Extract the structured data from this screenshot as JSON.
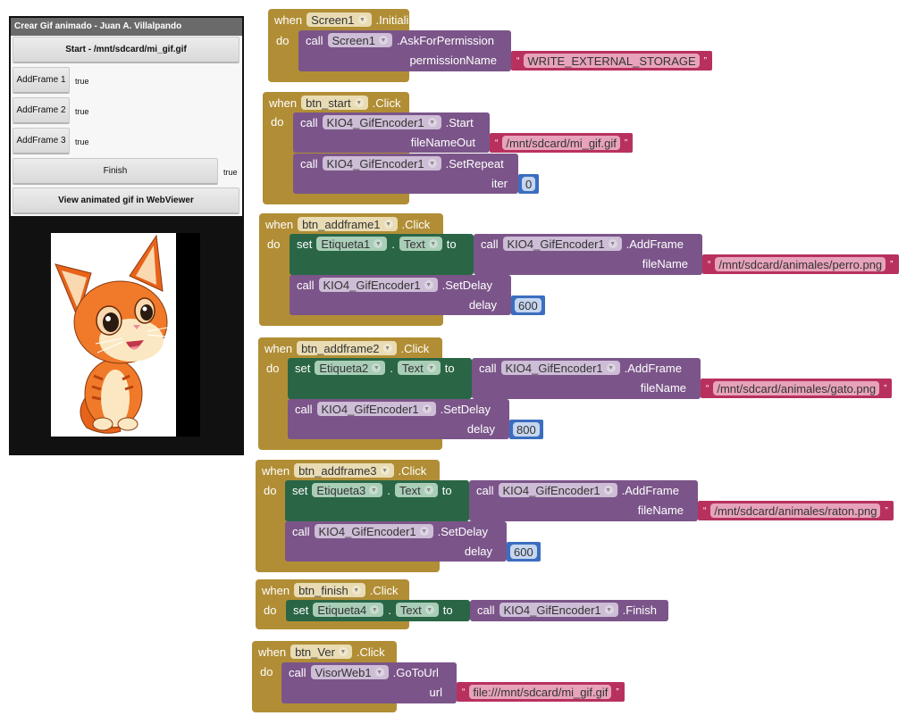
{
  "phone": {
    "title": "Crear Gif animado - Juan A. Villalpando",
    "btn_start": "Start - /mnt/sdcard/mi_gif.gif",
    "btn_addframe1": "AddFrame 1",
    "label1": "true",
    "btn_addframe2": "AddFrame 2",
    "label2": "true",
    "btn_addframe3": "AddFrame 3",
    "label3": "true",
    "btn_finish": "Finish",
    "label4": "true",
    "btn_ver": "View animated gif in WebViewer",
    "image": "orange-cartoon-cat"
  },
  "kw": {
    "when": "when",
    "do": "do",
    "call": "call",
    "set": "set",
    "to": "to",
    "dot": "."
  },
  "blocks": [
    {
      "component": "Screen1",
      "event": ".Initialize",
      "call_component": "Screen1",
      "method": ".AskForPermission",
      "param": "permissionName",
      "value": "WRITE_EXTERNAL_STORAGE"
    },
    {
      "component": "btn_start",
      "event": ".Click",
      "call_component": "KIO4_GifEncoder1",
      "method": ".Start",
      "param": "fileNameOut",
      "value": "/mnt/sdcard/mi_gif.gif",
      "call2_component": "KIO4_GifEncoder1",
      "method2": ".SetRepeat",
      "param2": "iter",
      "value2": "0"
    },
    {
      "component": "btn_addframe1",
      "event": ".Click",
      "set_component": "Etiqueta1",
      "property": "Text",
      "call_component": "KIO4_GifEncoder1",
      "method": ".AddFrame",
      "param": "fileName",
      "value": "/mnt/sdcard/animales/perro.png",
      "call2_component": "KIO4_GifEncoder1",
      "method2": ".SetDelay",
      "param2": "delay",
      "value2": "600"
    },
    {
      "component": "btn_addframe2",
      "event": ".Click",
      "set_component": "Etiqueta2",
      "property": "Text",
      "call_component": "KIO4_GifEncoder1",
      "method": ".AddFrame",
      "param": "fileName",
      "value": "/mnt/sdcard/animales/gato.png",
      "call2_component": "KIO4_GifEncoder1",
      "method2": ".SetDelay",
      "param2": "delay",
      "value2": "800"
    },
    {
      "component": "btn_addframe3",
      "event": ".Click",
      "set_component": "Etiqueta3",
      "property": "Text",
      "call_component": "KIO4_GifEncoder1",
      "method": ".AddFrame",
      "param": "fileName",
      "value": "/mnt/sdcard/animales/raton.png",
      "call2_component": "KIO4_GifEncoder1",
      "method2": ".SetDelay",
      "param2": "delay",
      "value2": "600"
    },
    {
      "component": "btn_finish",
      "event": ".Click",
      "set_component": "Etiqueta4",
      "property": "Text",
      "call_component": "KIO4_GifEncoder1",
      "method": ".Finish"
    },
    {
      "component": "btn_Ver",
      "event": ".Click",
      "call_component": "VisorWeb1",
      "method": ".GoToUrl",
      "param": "url",
      "value": "file:///mnt/sdcard/mi_gif.gif"
    }
  ],
  "colors": {
    "event": "#b18e35",
    "procedure": "#7b5589",
    "setter": "#2a6646",
    "text": "#b8315e",
    "math": "#3b6ec0"
  }
}
